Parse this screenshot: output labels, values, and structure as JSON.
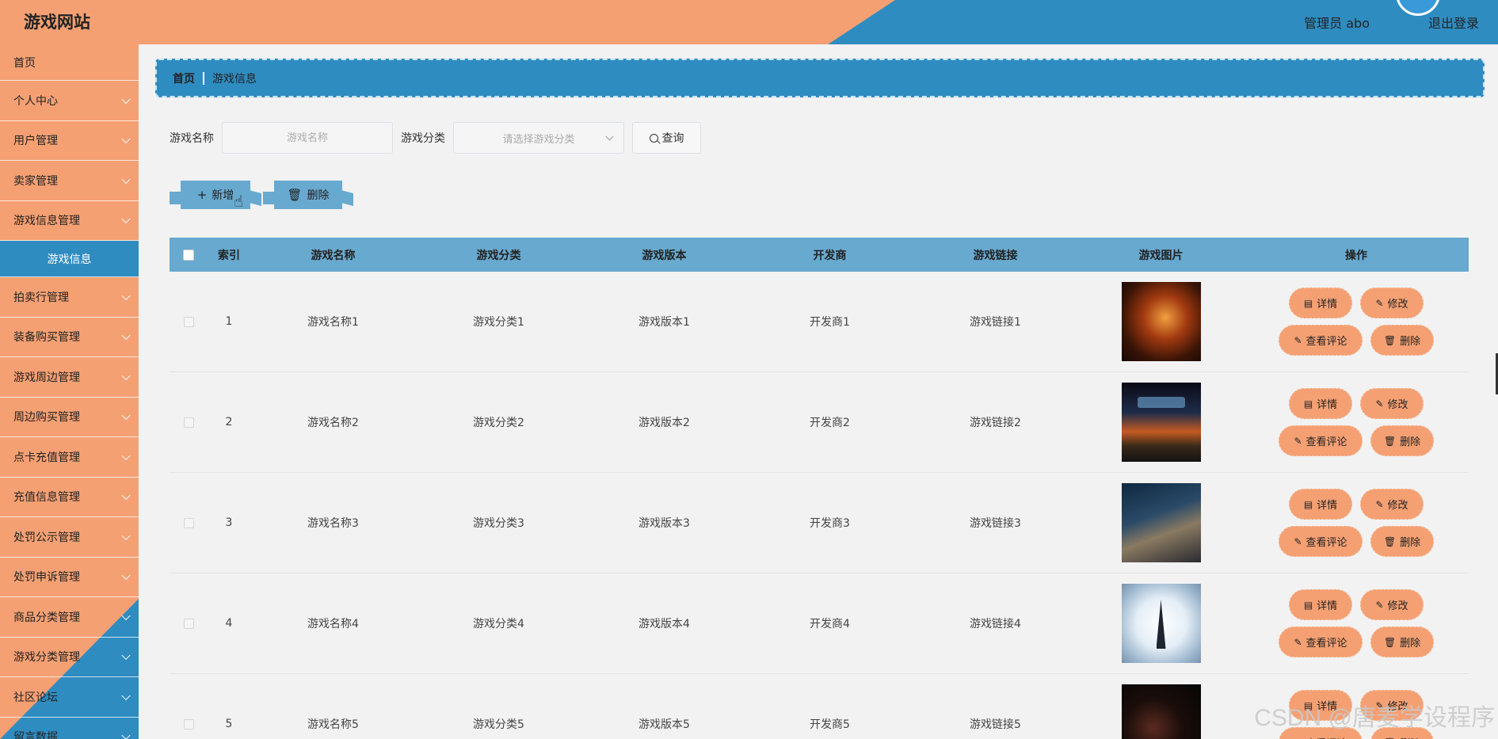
{
  "header": {
    "title": "游戏网站",
    "user_label": "管理员 abo",
    "logout_label": "退出登录"
  },
  "sidebar": {
    "items": [
      {
        "label": "首页",
        "has_children": false
      },
      {
        "label": "个人中心",
        "has_children": true
      },
      {
        "label": "用户管理",
        "has_children": true
      },
      {
        "label": "卖家管理",
        "has_children": true
      },
      {
        "label": "游戏信息管理",
        "has_children": true
      },
      {
        "label": "游戏信息",
        "has_children": false,
        "active": true
      },
      {
        "label": "拍卖行管理",
        "has_children": true
      },
      {
        "label": "装备购买管理",
        "has_children": true
      },
      {
        "label": "游戏周边管理",
        "has_children": true
      },
      {
        "label": "周边购买管理",
        "has_children": true
      },
      {
        "label": "点卡充值管理",
        "has_children": true
      },
      {
        "label": "充值信息管理",
        "has_children": true
      },
      {
        "label": "处罚公示管理",
        "has_children": true
      },
      {
        "label": "处罚申诉管理",
        "has_children": true
      },
      {
        "label": "商品分类管理",
        "has_children": true
      },
      {
        "label": "游戏分类管理",
        "has_children": true
      },
      {
        "label": "社区论坛",
        "has_children": true
      },
      {
        "label": "留言数据",
        "has_children": true
      }
    ]
  },
  "breadcrumb": {
    "home": "首页",
    "current": "游戏信息"
  },
  "search": {
    "name_label": "游戏名称",
    "name_placeholder": "游戏名称",
    "category_label": "游戏分类",
    "category_placeholder": "请选择游戏分类",
    "query_label": "查询"
  },
  "actions": {
    "add_label": "新增",
    "delete_label": "删除"
  },
  "table": {
    "headers": {
      "index": "索引",
      "name": "游戏名称",
      "category": "游戏分类",
      "version": "游戏版本",
      "developer": "开发商",
      "link": "游戏链接",
      "image": "游戏图片",
      "ops": "操作"
    },
    "op_labels": {
      "detail": "详情",
      "edit": "修改",
      "review": "查看评论",
      "delete": "删除"
    },
    "rows": [
      {
        "index": "1",
        "name": "游戏名称1",
        "category": "游戏分类1",
        "version": "游戏版本1",
        "developer": "开发商1",
        "link": "游戏链接1"
      },
      {
        "index": "2",
        "name": "游戏名称2",
        "category": "游戏分类2",
        "version": "游戏版本2",
        "developer": "开发商2",
        "link": "游戏链接2"
      },
      {
        "index": "3",
        "name": "游戏名称3",
        "category": "游戏分类3",
        "version": "游戏版本3",
        "developer": "开发商3",
        "link": "游戏链接3"
      },
      {
        "index": "4",
        "name": "游戏名称4",
        "category": "游戏分类4",
        "version": "游戏版本4",
        "developer": "开发商4",
        "link": "游戏链接4"
      },
      {
        "index": "5",
        "name": "游戏名称5",
        "category": "游戏分类5",
        "version": "游戏版本5",
        "developer": "开发商5",
        "link": "游戏链接5"
      }
    ]
  },
  "watermark": "CSDN @唐麦学设程序",
  "colors": {
    "orange": "#f4a073",
    "blue": "#2f8cc1",
    "table_header": "#68a9cf"
  }
}
